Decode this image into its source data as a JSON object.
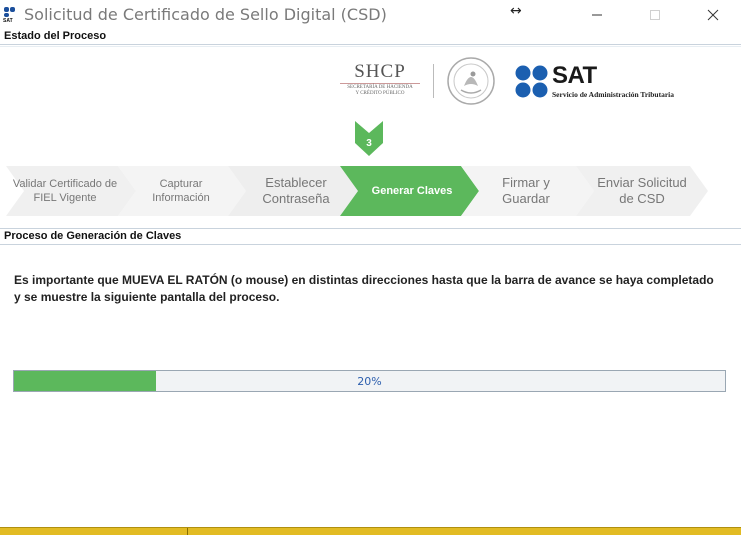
{
  "window": {
    "title": "Solicitud de Certificado de Sello Digital (CSD)",
    "resize_glyph": "↔",
    "icons": [
      "sat-app-icon",
      "minimize-icon",
      "maximize-icon",
      "close-icon"
    ]
  },
  "sections": {
    "estado": "Estado del Proceso",
    "proceso": "Proceso de Generación de Claves"
  },
  "logos": {
    "shcp_title": "SHCP",
    "shcp_sub_line1": "SECRETARÍA DE HACIENDA",
    "shcp_sub_line2": "Y CRÉDITO PÚBLICO",
    "sat_title": "SAT",
    "sat_sub": "Servicio de Administración Tributaria"
  },
  "current_step": "3",
  "steps": [
    {
      "label": "Validar Certificado de FIEL Vigente"
    },
    {
      "label": "Capturar Información"
    },
    {
      "label": "Establecer Contraseña"
    },
    {
      "label": "Generar Claves"
    },
    {
      "label": "Firmar y Guardar"
    },
    {
      "label": "Enviar Solicitud de CSD"
    }
  ],
  "instructions": "Es importante que MUEVA EL RATÓN (o mouse) en distintas direcciones hasta que la barra de avance se haya completado y se muestre la siguiente pantalla del proceso.",
  "progress": {
    "value": 0.2,
    "label": "20%"
  },
  "colors": {
    "accent_green": "#5cb85c",
    "step_gray": "#eeeeee",
    "status_yellow": "#e2bb23",
    "progress_text": "#2d5fae"
  }
}
